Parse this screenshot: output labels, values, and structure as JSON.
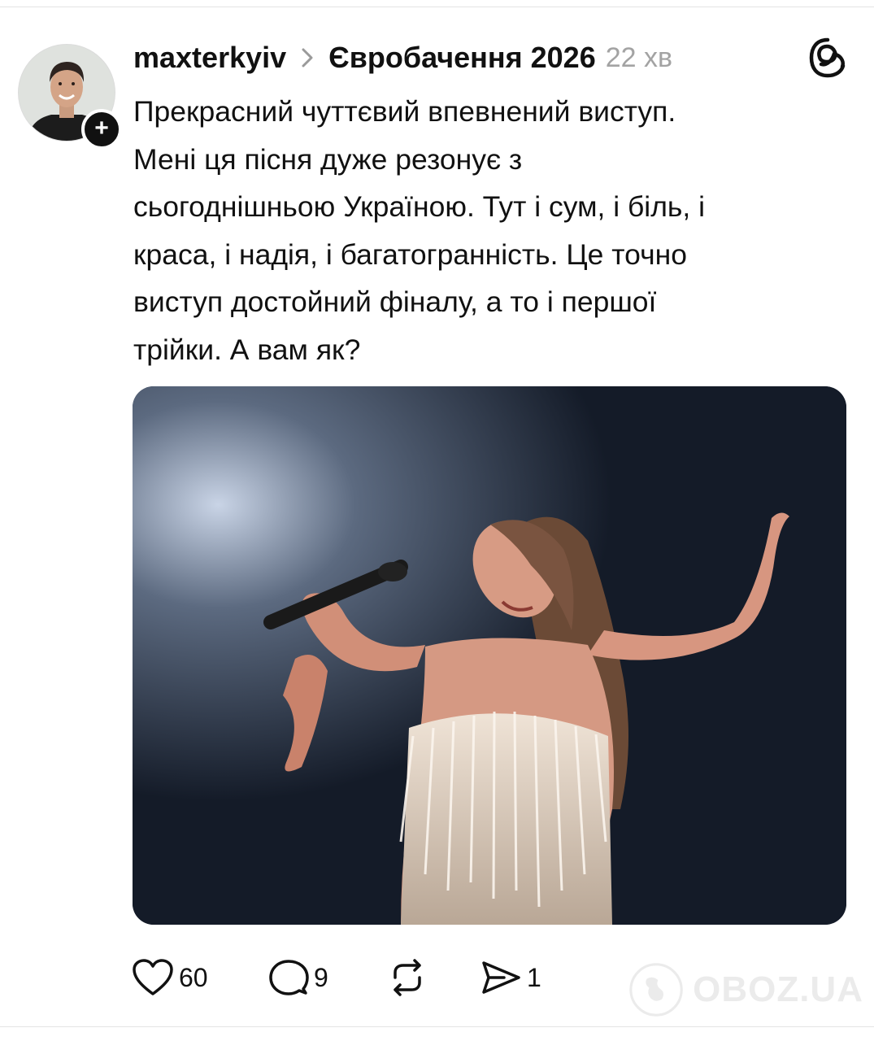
{
  "post": {
    "username": "maxterkyiv",
    "community": "Євробачення 2026",
    "time": "22 хв",
    "text_lines": [
      "Прекрасний чуттєвий впевнений виступ.",
      "Мені ця пісня дуже резонує з",
      "сьогоднішньою Україною. Тут і сум, і біль, і",
      "краса, і надія, і багатогранність. Це точно",
      "виступ достойний фіналу, а то і першої",
      "трійки. А вам як?"
    ],
    "follow_symbol": "+"
  },
  "actions": {
    "likes": "60",
    "replies": "9",
    "reposts": "",
    "shares": "1"
  },
  "icons": {
    "like": "heart-icon",
    "reply": "comment-icon",
    "repost": "repost-icon",
    "share": "send-icon",
    "logo": "threads-logo-icon",
    "chevron": "chevron-right-icon"
  },
  "watermark": {
    "text": "OBOZ.UA"
  },
  "colors": {
    "text": "#111111",
    "muted": "#a3a3a3",
    "badge": "#111111"
  }
}
